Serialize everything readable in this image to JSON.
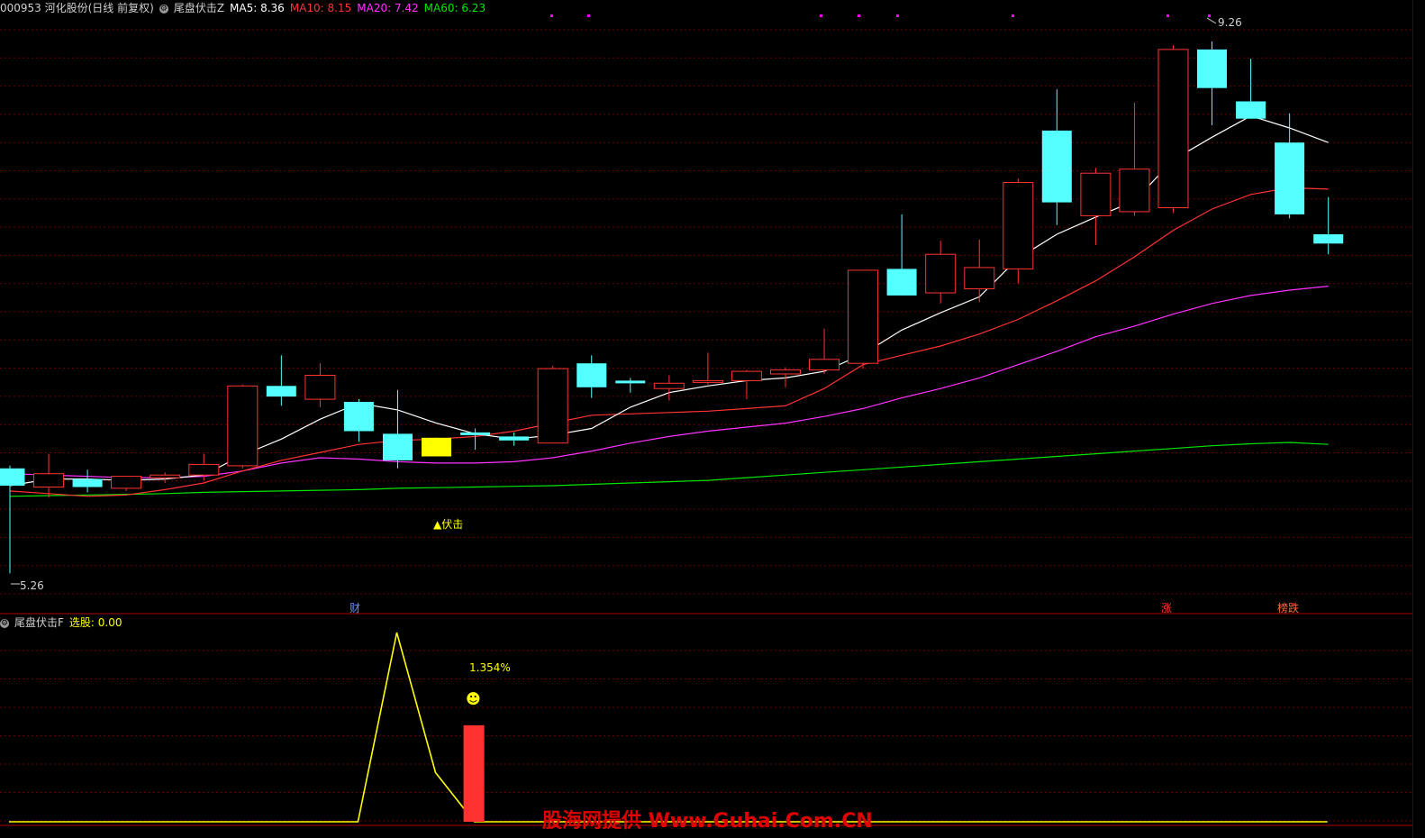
{
  "main_header": {
    "stock": "000953 河化股份(日线 前复权)",
    "indicator": "尾盘伏击Z",
    "ma5": "MA5: 8.36",
    "ma10": "MA10: 8.15",
    "ma20": "MA20: 7.42",
    "ma60": "MA60: 6.23"
  },
  "sub_header": {
    "indicator": "尾盘伏击F",
    "select": "选股: 0.00"
  },
  "colors": {
    "up": "#ff3232",
    "down": "#54ffff",
    "signal": "#ffff00",
    "ma5": "#ffffff",
    "ma10": "#ff3232",
    "ma20": "#ff32ff",
    "ma60": "#00e600",
    "grid": "#6b0000",
    "mark": "#ff00ff"
  },
  "annotations": {
    "high_label": "9.26",
    "low_label": "5.26",
    "signal_label": "▲伏击",
    "pct_label": "1.354%",
    "smiley": "☻",
    "event_cai": "财",
    "event_zhang": "涨",
    "event_bang": "榜跌"
  },
  "watermark": "股海网提供 Www.Guhai.Com.CN",
  "chart_data": [
    {
      "type": "candlestick",
      "ylim": [
        5.1,
        9.45
      ],
      "candles": [
        {
          "o": 6.05,
          "h": 6.07,
          "l": 5.26,
          "c": 5.92
        },
        {
          "o": 5.91,
          "h": 6.16,
          "l": 5.83,
          "c": 6.01
        },
        {
          "o": 5.97,
          "h": 6.04,
          "l": 5.87,
          "c": 5.91
        },
        {
          "o": 5.9,
          "h": 5.99,
          "l": 5.88,
          "c": 5.99
        },
        {
          "o": 5.98,
          "h": 6.02,
          "l": 5.94,
          "c": 6.0
        },
        {
          "o": 6.0,
          "h": 6.16,
          "l": 5.96,
          "c": 6.08
        },
        {
          "o": 6.07,
          "h": 6.68,
          "l": 6.05,
          "c": 6.67
        },
        {
          "o": 6.67,
          "h": 6.9,
          "l": 6.52,
          "c": 6.59
        },
        {
          "o": 6.57,
          "h": 6.84,
          "l": 6.51,
          "c": 6.75
        },
        {
          "o": 6.55,
          "h": 6.57,
          "l": 6.25,
          "c": 6.33
        },
        {
          "o": 6.31,
          "h": 6.64,
          "l": 6.05,
          "c": 6.11
        },
        {
          "o": 6.28,
          "h": 6.26,
          "l": 6.14,
          "c": 6.14
        },
        {
          "o": 6.32,
          "h": 6.35,
          "l": 6.19,
          "c": 6.3
        },
        {
          "o": 6.29,
          "h": 6.32,
          "l": 6.22,
          "c": 6.26
        },
        {
          "o": 6.24,
          "h": 6.82,
          "l": 6.24,
          "c": 6.8
        },
        {
          "o": 6.84,
          "h": 6.9,
          "l": 6.58,
          "c": 6.66
        },
        {
          "o": 6.71,
          "h": 6.73,
          "l": 6.62,
          "c": 6.69
        },
        {
          "o": 6.65,
          "h": 6.75,
          "l": 6.56,
          "c": 6.69
        },
        {
          "o": 6.7,
          "h": 6.92,
          "l": 6.68,
          "c": 6.71
        },
        {
          "o": 6.71,
          "h": 6.79,
          "l": 6.57,
          "c": 6.78
        },
        {
          "o": 6.76,
          "h": 6.81,
          "l": 6.66,
          "c": 6.79
        },
        {
          "o": 6.79,
          "h": 7.1,
          "l": 6.76,
          "c": 6.87
        },
        {
          "o": 6.84,
          "h": 7.46,
          "l": 6.8,
          "c": 7.54
        },
        {
          "o": 7.55,
          "h": 7.96,
          "l": 7.47,
          "c": 7.35
        },
        {
          "o": 7.37,
          "h": 7.76,
          "l": 7.29,
          "c": 7.66
        },
        {
          "o": 7.4,
          "h": 7.77,
          "l": 7.3,
          "c": 7.56
        },
        {
          "o": 7.55,
          "h": 8.23,
          "l": 7.44,
          "c": 8.2
        },
        {
          "o": 8.59,
          "h": 8.9,
          "l": 7.88,
          "c": 8.05
        },
        {
          "o": 7.95,
          "h": 8.31,
          "l": 7.73,
          "c": 8.27
        },
        {
          "o": 7.98,
          "h": 8.8,
          "l": 7.95,
          "c": 8.3
        },
        {
          "o": 8.01,
          "h": 9.23,
          "l": 7.97,
          "c": 9.2
        },
        {
          "o": 9.2,
          "h": 9.26,
          "l": 8.63,
          "c": 8.91
        },
        {
          "o": 8.81,
          "h": 9.13,
          "l": 8.72,
          "c": 8.68
        },
        {
          "o": 8.5,
          "h": 8.72,
          "l": 7.93,
          "c": 7.96
        },
        {
          "o": 7.81,
          "h": 8.09,
          "l": 7.66,
          "c": 7.74
        }
      ],
      "ma5": [
        5.92,
        5.97,
        5.97,
        5.96,
        5.97,
        6.0,
        6.15,
        6.27,
        6.42,
        6.54,
        6.49,
        6.39,
        6.31,
        6.27,
        6.3,
        6.35,
        6.51,
        6.62,
        6.67,
        6.71,
        6.73,
        6.78,
        6.91,
        7.09,
        7.22,
        7.34,
        7.63,
        7.81,
        7.94,
        8.06,
        8.37,
        8.54,
        8.7,
        8.61,
        8.5
      ],
      "ma10": [
        5.88,
        5.86,
        5.84,
        5.85,
        5.89,
        5.94,
        6.03,
        6.11,
        6.17,
        6.23,
        6.26,
        6.27,
        6.29,
        6.33,
        6.39,
        6.45,
        6.46,
        6.47,
        6.48,
        6.5,
        6.52,
        6.65,
        6.83,
        6.9,
        6.97,
        7.06,
        7.17,
        7.31,
        7.46,
        7.64,
        7.84,
        8.0,
        8.11,
        8.16,
        8.15
      ],
      "ma20": [
        6.01,
        6.0,
        5.99,
        5.98,
        5.98,
        5.99,
        6.03,
        6.09,
        6.13,
        6.12,
        6.1,
        6.09,
        6.09,
        6.1,
        6.13,
        6.18,
        6.24,
        6.29,
        6.33,
        6.36,
        6.39,
        6.44,
        6.5,
        6.58,
        6.65,
        6.73,
        6.83,
        6.93,
        7.04,
        7.12,
        7.21,
        7.29,
        7.35,
        7.39,
        7.42
      ],
      "ma60": [
        5.84,
        5.845,
        5.85,
        5.855,
        5.86,
        5.87,
        5.875,
        5.88,
        5.885,
        5.89,
        5.9,
        5.905,
        5.91,
        5.915,
        5.92,
        5.93,
        5.94,
        5.95,
        5.96,
        5.98,
        6.0,
        6.02,
        6.04,
        6.06,
        6.08,
        6.1,
        6.12,
        6.14,
        6.16,
        6.18,
        6.2,
        6.22,
        6.235,
        6.245,
        6.23
      ]
    },
    {
      "type": "line",
      "series": [
        {
          "values": [
            0,
            0,
            0,
            0,
            0,
            0,
            0,
            0,
            0,
            0,
            1,
            0.26,
            0,
            0,
            0,
            0,
            0,
            0,
            0,
            0,
            0,
            0,
            0,
            0,
            0,
            0,
            0,
            0,
            0,
            0,
            0,
            0,
            0,
            0,
            0
          ]
        }
      ],
      "bars": [
        {
          "index": 12,
          "value": 0.51
        }
      ],
      "ylim": [
        0,
        1
      ]
    }
  ]
}
